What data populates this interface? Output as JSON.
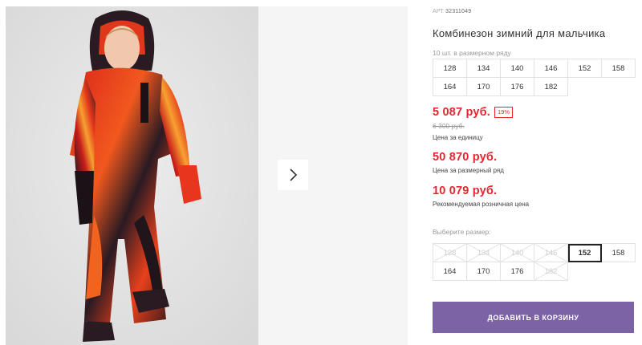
{
  "gallery": {
    "photo_alt": "boy-in-winter-jumpsuit",
    "next_icon": "chevron-right-icon"
  },
  "product": {
    "article_label": "АРТ",
    "article_number": "32311049",
    "title": "Комбинезон зимний для мальчика",
    "row_note": "10 шт. в размерном ряду",
    "size_row": [
      "128",
      "134",
      "140",
      "146",
      "152",
      "158",
      "164",
      "170",
      "176",
      "182"
    ]
  },
  "pricing": {
    "unit_price": "5 087 руб.",
    "discount": "19%",
    "old_price": "6 300 руб.",
    "unit_label": "Цена за единицу",
    "row_price": "50 870 руб.",
    "row_label": "Цена за размерный ряд",
    "retail_price": "10 079 руб.",
    "retail_label": "Рекомендуемая розничная цена"
  },
  "size_select": {
    "label": "Выберите размер:",
    "options": [
      {
        "size": "128",
        "available": false
      },
      {
        "size": "134",
        "available": false
      },
      {
        "size": "140",
        "available": false
      },
      {
        "size": "146",
        "available": false
      },
      {
        "size": "152",
        "available": true,
        "selected": true
      },
      {
        "size": "158",
        "available": true
      },
      {
        "size": "164",
        "available": true
      },
      {
        "size": "170",
        "available": true
      },
      {
        "size": "176",
        "available": true
      },
      {
        "size": "182",
        "available": false
      }
    ]
  },
  "cart": {
    "add_label": "ДОБАВИТЬ В КОРЗИНУ"
  },
  "colors": {
    "price_red": "#e5262f",
    "button_purple": "#7b63a6"
  }
}
